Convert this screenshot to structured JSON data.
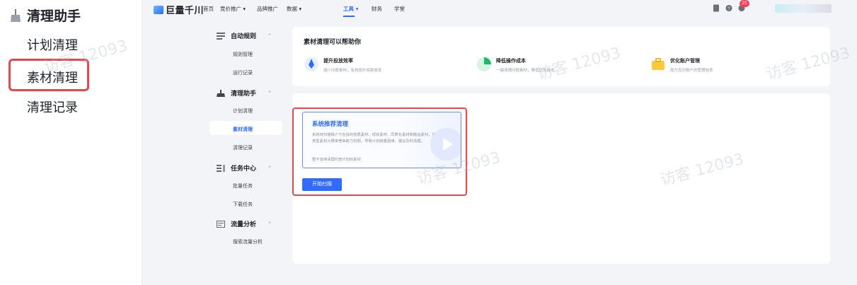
{
  "left_panel": {
    "header": "清理助手",
    "items": [
      "计划清理",
      "素材清理",
      "清理记录"
    ]
  },
  "topnav": {
    "logo": "巨量千川",
    "items": [
      {
        "label": "首页"
      },
      {
        "label": "竞价推广 ▾"
      },
      {
        "label": "品牌推广"
      },
      {
        "label": "数据 ▾"
      },
      {
        "label": "工具 ▾",
        "active": true
      },
      {
        "label": "财务"
      },
      {
        "label": "学堂"
      }
    ],
    "notification_count": "25"
  },
  "sidemenu": {
    "groups": [
      {
        "label": "自动规则",
        "caret": "^",
        "subs": [
          "规则管理",
          "运行记录"
        ]
      },
      {
        "label": "清理助手",
        "caret": "^",
        "subs": [
          "计划清理",
          "素材清理",
          "清理记录"
        ]
      },
      {
        "label": "任务中心",
        "caret": "^",
        "subs": [
          "批量任务",
          "下载任务"
        ]
      },
      {
        "label": "流量分析",
        "caret": "^",
        "subs": [
          "搜索流量分析"
        ]
      }
    ],
    "active_sub": "素材清理"
  },
  "intro_card": {
    "title": "素材清理可以帮助你",
    "features": [
      {
        "title": "提升投放效率",
        "desc": "减少问题素材，有效提升探索效率"
      },
      {
        "title": "降低操作成本",
        "desc": "一键清理问题素材，降低优化成本"
      },
      {
        "title": "优化账户管理",
        "desc": "提升您对账户的管理效率"
      }
    ]
  },
  "recommend": {
    "title": "系统推荐清理",
    "desc": "系统将扫描账户下在投的低质素材、低效素材、同质化素材和搬运素材，该类型素材大概率竞争能力较弱，导致计划跑量困难，建议及时清理。",
    "note": "暂不支持清理托管计划的素材",
    "button": "开始扫描"
  },
  "watermark": "访客 12093",
  "colors": {
    "accent": "#2f6cff",
    "highlight": "#e5484d",
    "badge": "#f5405c"
  }
}
